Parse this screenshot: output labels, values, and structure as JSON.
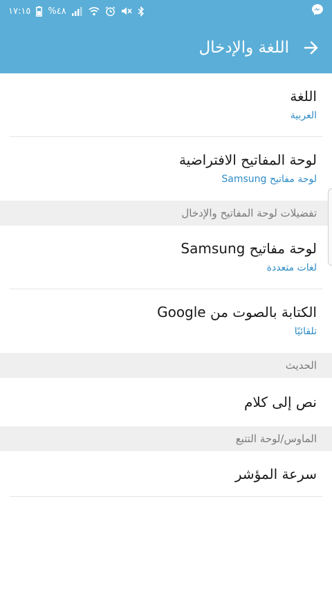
{
  "status": {
    "time": "١٧:١٥",
    "battery": "%٤٨"
  },
  "appbar": {
    "title": "اللغة والإدخال"
  },
  "items": [
    {
      "title": "اللغة",
      "sub": "العربية"
    },
    {
      "title": "لوحة المفاتيح الافتراضية",
      "sub": "لوحة مفاتيح Samsung"
    }
  ],
  "section1": "تفضيلات لوحة المفاتيح والإدخال",
  "items2": [
    {
      "title": "لوحة مفاتيح Samsung",
      "sub": "لغات متعددة"
    },
    {
      "title": "الكتابة بالصوت من Google",
      "sub": "تلقائيًا"
    }
  ],
  "section2": "الحديث",
  "tts": {
    "title": "نص إلى كلام"
  },
  "section3": "الماوس/لوحة التتبع",
  "pointer": {
    "title": "سرعة المؤشر"
  }
}
